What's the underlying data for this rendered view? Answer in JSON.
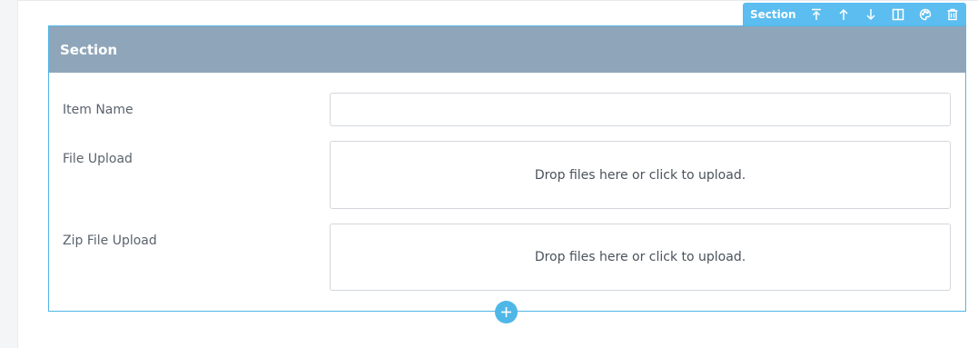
{
  "toolbar": {
    "label": "Section",
    "buttons": [
      {
        "icon": "move-up-icon"
      },
      {
        "icon": "arrow-up-icon"
      },
      {
        "icon": "arrow-down-icon"
      },
      {
        "icon": "columns-icon"
      },
      {
        "icon": "palette-icon"
      },
      {
        "icon": "trash-icon"
      }
    ]
  },
  "section": {
    "title": "Section",
    "fields": [
      {
        "label": "Item Name",
        "type": "text",
        "value": ""
      },
      {
        "label": "File Upload",
        "type": "file",
        "dropzone_text": "Drop files here or click to upload."
      },
      {
        "label": "Zip File Upload",
        "type": "file",
        "dropzone_text": "Drop files here or click to upload."
      }
    ]
  },
  "add_button": {
    "icon": "plus-icon"
  },
  "colors": {
    "accent": "#4fb7e8",
    "toolbar": "#5bbdf0",
    "header": "#8fa6ba"
  }
}
